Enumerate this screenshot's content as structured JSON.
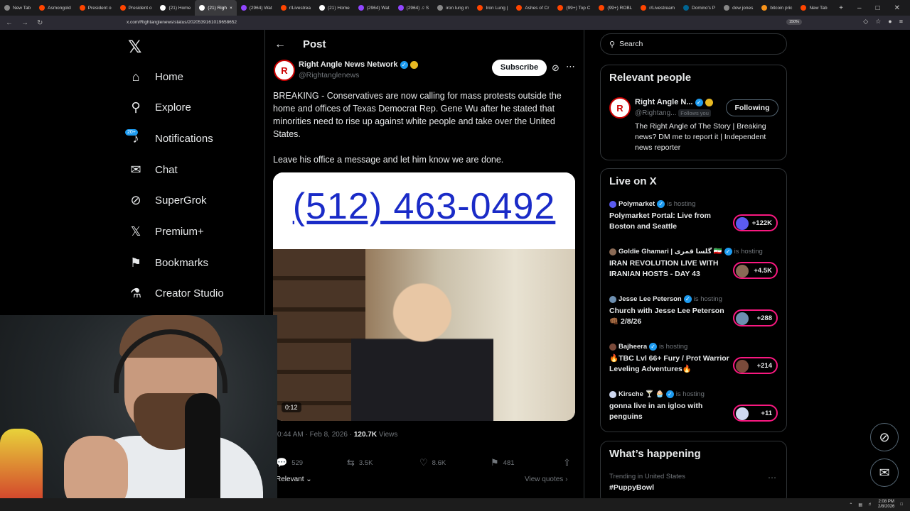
{
  "browser": {
    "tabs": [
      "New Tab",
      "Asmongold",
      "President o",
      "President o",
      "(21) Home",
      "(21) Righ",
      "(2964) Wat",
      "r/Livestrea",
      "(21) Home",
      "(2964) Wat",
      "(2964) ♫ S",
      "iron lung m",
      "Iron Lung |",
      "Ashes of Cr",
      "(99+) Top C",
      "(99+) ROBL",
      "r/Livestream",
      "Domino's P",
      "dow jones",
      "bitcoin pric",
      "New Tab"
    ],
    "url": "x.com/Rightanglenews/status/2020539161019658652",
    "zoom": "150%"
  },
  "nav": {
    "items": [
      {
        "label": "Home",
        "icon": "home-icon"
      },
      {
        "label": "Explore",
        "icon": "search-icon"
      },
      {
        "label": "Notifications",
        "icon": "bell-icon"
      },
      {
        "label": "Chat",
        "icon": "mail-icon"
      },
      {
        "label": "SuperGrok",
        "icon": "grok-icon"
      },
      {
        "label": "Premium+",
        "icon": "x-logo-icon"
      },
      {
        "label": "Bookmarks",
        "icon": "bookmark-icon"
      },
      {
        "label": "Creator Studio",
        "icon": "creator-icon"
      }
    ],
    "notifications_badge": "20+"
  },
  "post": {
    "header": "Post",
    "author_name": "Right Angle News Network",
    "handle": "@Rightanglenews",
    "subscribe_label": "Subscribe",
    "text_p1": "BREAKING - Conservatives are now calling for mass protests outside the home and offices of Texas Democrat Rep. Gene Wu after he stated that minorities need to rise up against white people and take over the United States.",
    "text_p2": "Leave his office a message and let him know we are done.",
    "phone": "(512) 463-0492",
    "video_time": "0:12",
    "timestamp": "0:44 AM · Feb 8, 2026 ·",
    "views_count": "120.7K",
    "views_label": "Views",
    "replies": "529",
    "reposts": "3.5K",
    "likes": "8.6K",
    "bookmarks": "481",
    "sort_label": "Relevant",
    "view_quotes": "View quotes"
  },
  "sidebar": {
    "search_placeholder": "Search",
    "relevant_title": "Relevant people",
    "person_name": "Right Angle N...",
    "person_handle": "@Rightang...",
    "follows_you": "Follows you",
    "following_label": "Following",
    "person_bio": "The Right Angle of The Story | Breaking news? DM me to report it | Independent news reporter",
    "live_title": "Live on X",
    "is_hosting": "is hosting",
    "live": [
      {
        "host": "Polymarket",
        "title": "Polymarket Portal: Live from Boston and Seattle",
        "count": "+122K"
      },
      {
        "host": "Goldie Ghamari | گلسا قمری 🇮🇷",
        "title": "IRAN REVOLUTION LIVE WITH IRANIAN HOSTS - DAY 43",
        "count": "+4.5K"
      },
      {
        "host": "Jesse Lee Peterson",
        "title": "Church with Jesse Lee Peterson 👊🏾 2/8/26",
        "count": "+288"
      },
      {
        "host": "Bajheera",
        "title": "🔥TBC Lvl 66+ Fury / Prot Warrior Leveling Adventures🔥",
        "count": "+214"
      },
      {
        "host": "Kirsche 🍸 🧁",
        "title": "gonna live in an igloo with penguins",
        "count": "+11"
      }
    ],
    "happening_title": "What’s happening",
    "trend_context": "Trending in United States",
    "trend_name": "#PuppyBowl"
  },
  "taskbar": {
    "time": "2:08 PM",
    "date": "2/8/2026"
  }
}
